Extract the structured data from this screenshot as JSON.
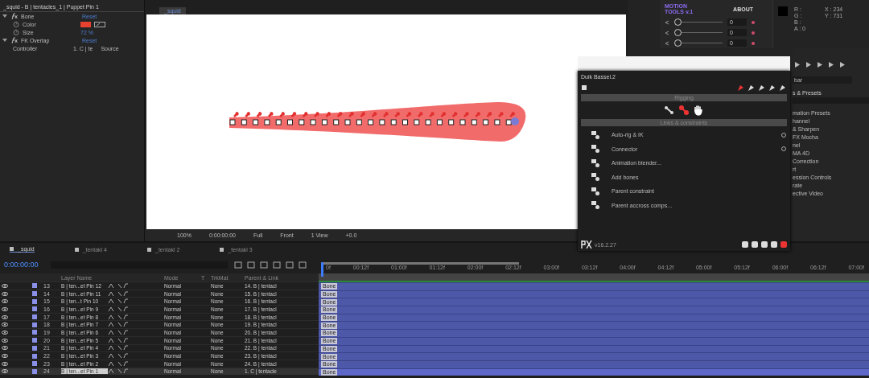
{
  "effect_controls": {
    "title": "_squid - B | tentacles_1 | Puppet Pin 1",
    "effects": [
      {
        "name": "Bone",
        "reset": "Reset",
        "expanded": true,
        "properties": [
          {
            "kind": "color",
            "name": "Color",
            "color": "#e8412f"
          },
          {
            "kind": "value",
            "name": "Size",
            "value": "72 %"
          }
        ]
      },
      {
        "name": "FK Overlap",
        "reset": "Reset",
        "expanded": true,
        "properties": [
          {
            "kind": "dropdown",
            "name": "Controller",
            "value": "1. C | te",
            "source": "Source"
          }
        ]
      }
    ]
  },
  "viewer": {
    "tab": "_squid",
    "toolbar": [
      "100%",
      "0:00:00:00",
      "Full",
      "Front",
      "1 View",
      "+0.0"
    ]
  },
  "motion_tools": {
    "logo": "MOTION TOOLS v.1",
    "about": "ABOUT",
    "sliders": [
      {
        "level": 0,
        "value": "0"
      },
      {
        "level": 0,
        "value": "0"
      },
      {
        "level": 0,
        "value": "0"
      }
    ]
  },
  "info": {
    "channels": [
      "R :",
      "G :",
      "B :",
      "A : 0"
    ],
    "coords": [
      "X : 234",
      "Y : 731"
    ]
  },
  "right_panel": {
    "dropdown": "bar",
    "title": "s & Presets",
    "items": [
      "mation Presets",
      "hannel",
      "& Sharpen",
      "FX Mocha",
      "nel",
      "MA 4D",
      "Correction",
      "rt",
      "ession Controls",
      "rate",
      "ective Video"
    ]
  },
  "duik": {
    "title": "Duik Bassel.2",
    "sections": [
      "Rigging",
      "Links & constraints"
    ],
    "version": "v16.2.27",
    "tools": [
      {
        "label": "Auto-rig & IK",
        "has_options": true
      },
      {
        "label": "Connector",
        "has_options": true
      },
      {
        "label": "Animation blender...",
        "has_options": false
      },
      {
        "label": "Add bones",
        "has_options": false
      },
      {
        "label": "Parent constraint",
        "has_options": false
      },
      {
        "label": "Parent accross comps...",
        "has_options": false
      }
    ]
  },
  "timeline": {
    "tabs": [
      {
        "label": "_squid",
        "selected": true
      },
      {
        "label": "_tentakl 4",
        "selected": false
      },
      {
        "label": "_tentakl 2",
        "selected": false
      },
      {
        "label": "_tentakl 3",
        "selected": false
      }
    ],
    "time": "0:00:00:00",
    "columns": [
      "Layer Name",
      "Mode",
      "T",
      "TrkMat",
      "Parent & Link"
    ],
    "ruler": [
      "0f",
      "00:12f",
      "01:00f",
      "01:12f",
      "02:00f",
      "02:12f",
      "03:00f",
      "03:12f",
      "04:00f",
      "04:12f",
      "05:00f",
      "05:12f",
      "06:00f",
      "06:12f",
      "07:00f"
    ],
    "layers": [
      {
        "number": "13",
        "name": "B | ten...et Pin 12",
        "mode": "Normal",
        "trkmat": "None",
        "parent": "14. B | tentacl",
        "visible": true,
        "selected": false,
        "bar_label": "Bone"
      },
      {
        "number": "14",
        "name": "B | ten...et Pin 11",
        "mode": "Normal",
        "trkmat": "None",
        "parent": "15. B | tentacl",
        "visible": true,
        "selected": false,
        "bar_label": "Bone"
      },
      {
        "number": "15",
        "name": "B | ten...t Pin 10",
        "mode": "Normal",
        "trkmat": "None",
        "parent": "16. B | tentacl",
        "visible": true,
        "selected": false,
        "bar_label": "Bone"
      },
      {
        "number": "16",
        "name": "B | ten...et Pin 9",
        "mode": "Normal",
        "trkmat": "None",
        "parent": "17. B | tentacl",
        "visible": true,
        "selected": false,
        "bar_label": "Bone"
      },
      {
        "number": "17",
        "name": "B | ten...et Pin 8",
        "mode": "Normal",
        "trkmat": "None",
        "parent": "18. B | tentacl",
        "visible": true,
        "selected": false,
        "bar_label": "Bone"
      },
      {
        "number": "18",
        "name": "B | ten...et Pin 7",
        "mode": "Normal",
        "trkmat": "None",
        "parent": "19. B | tentacl",
        "visible": true,
        "selected": false,
        "bar_label": "Bone"
      },
      {
        "number": "19",
        "name": "B | ten...et Pin 6",
        "mode": "Normal",
        "trkmat": "None",
        "parent": "20. B | tentacl",
        "visible": true,
        "selected": false,
        "bar_label": "Bone"
      },
      {
        "number": "20",
        "name": "B | ten...et Pin 5",
        "mode": "Normal",
        "trkmat": "None",
        "parent": "21. B | tentacl",
        "visible": true,
        "selected": false,
        "bar_label": "Bone"
      },
      {
        "number": "21",
        "name": "B | ten...et Pin 4",
        "mode": "Normal",
        "trkmat": "None",
        "parent": "22. B | tentacl",
        "visible": true,
        "selected": false,
        "bar_label": "Bone"
      },
      {
        "number": "22",
        "name": "B | ten...et Pin 3",
        "mode": "Normal",
        "trkmat": "None",
        "parent": "23. B | tentacl",
        "visible": true,
        "selected": false,
        "bar_label": "Bone"
      },
      {
        "number": "23",
        "name": "B | ten...et Pin 2",
        "mode": "Normal",
        "trkmat": "None",
        "parent": "24. B | tentacl",
        "visible": true,
        "selected": false,
        "bar_label": "Bone"
      },
      {
        "number": "24",
        "name": "B | ten...et Pin 1",
        "mode": "Normal",
        "trkmat": "None",
        "parent": "1. C | tentacle",
        "visible": true,
        "selected": true,
        "bar_label": "Bone"
      }
    ]
  }
}
